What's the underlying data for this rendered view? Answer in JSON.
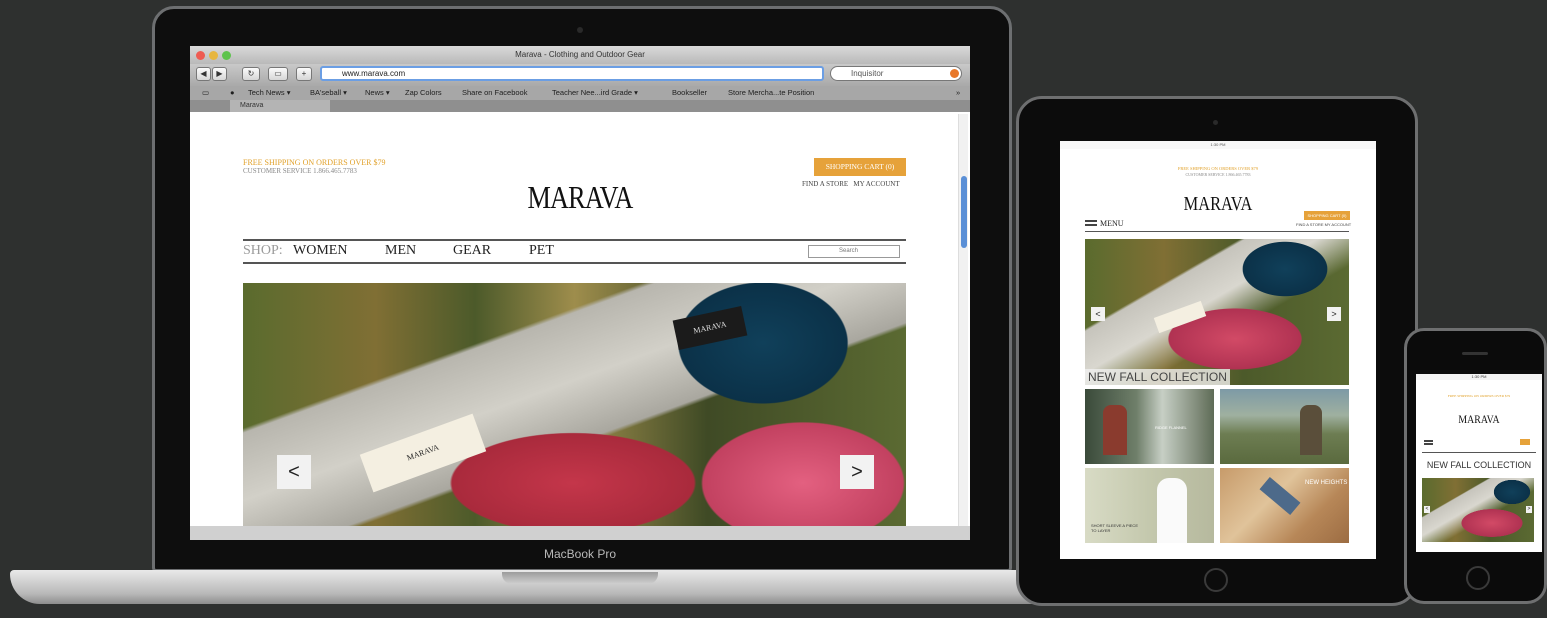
{
  "laptop": {
    "model_label": "MacBook Pro",
    "browser": {
      "window_title": "Marava - Clothing and Outdoor Gear",
      "url": "www.marava.com",
      "search_placeholder": "Inquisitor",
      "bookmarks": [
        "Tech News ▾",
        "BA'seball ▾",
        "News ▾",
        "Zap Colors",
        "Share on Facebook",
        "Teacher Nee...ird Grade ▾",
        "Bookseller",
        "Store Mercha...te Position"
      ],
      "tab_label": "Marava",
      "nav_back": "◀",
      "nav_forward": "▶",
      "reload": "↻",
      "add": "+"
    },
    "site": {
      "promo": "FREE SHIPPING ON ORDERS OVER $79",
      "customer_service": "CUSTOMER SERVICE 1.866.465.7783",
      "cart_label": "SHOPPING CART (0)",
      "find_store": "FIND A STORE",
      "my_account": "MY ACCOUNT",
      "logo": "MARAVA",
      "shop_label": "SHOP:",
      "nav_items": [
        "WOMEN",
        "MEN",
        "GEAR",
        "PET"
      ],
      "search_placeholder": "Search",
      "hero_prev": "<",
      "hero_next": ">",
      "hero_tag_text": "MARAVA"
    }
  },
  "tablet": {
    "status_time": "1:30 PM",
    "promo": "FREE SHIPPING ON ORDERS OVER $79",
    "customer_service": "CUSTOMER SERVICE 1.866.465.7783",
    "logo": "MARAVA",
    "menu_label": "MENU",
    "cart_label": "SHOPPING CART (0)",
    "links": "FIND A STORE   MY ACCOUNT",
    "hero_caption": "NEW FALL COLLECTION",
    "hero_prev": "<",
    "hero_next": ">",
    "tiles": [
      {
        "label": "RIDGE FLANNEL"
      },
      {
        "label": ""
      },
      {
        "label": "SHORT SLEEVE A PIECE TO LAYER"
      },
      {
        "label": "NEW HEIGHTS"
      }
    ]
  },
  "phone": {
    "status_time": "1:30 PM",
    "promo": "FREE SHIPPING ON ORDERS OVER $79",
    "logo": "MARAVA",
    "collection_label": "NEW FALL COLLECTION",
    "hero_prev": "<",
    "hero_next": ">"
  },
  "colors": {
    "background": "#2e302f",
    "accent_orange": "#e6a23a",
    "url_focus": "#6b9ee4"
  }
}
